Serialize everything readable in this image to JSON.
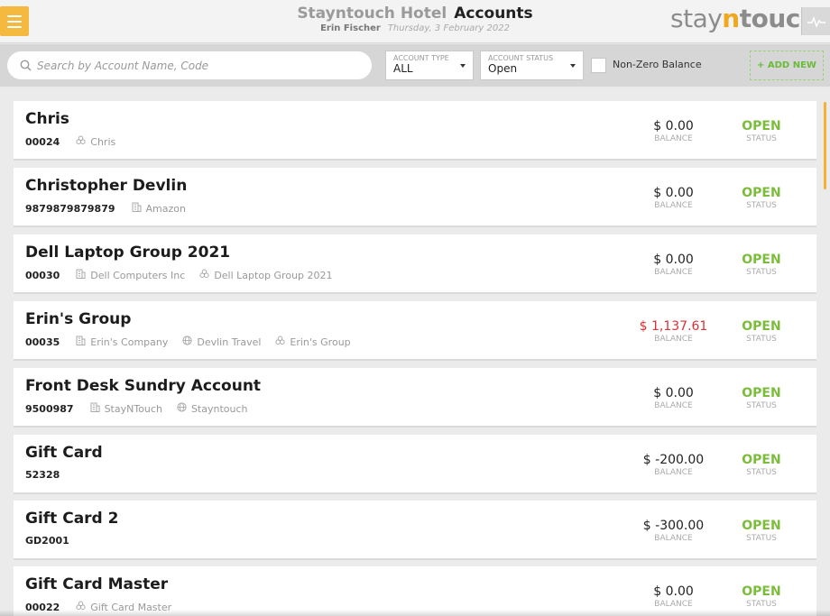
{
  "header": {
    "hotel_name": "Stayntouch Hotel",
    "page_title": "Accounts",
    "user_name": "Erin Fischer",
    "date": "Thursday, 3 February 2022",
    "logo": {
      "part1": "stay",
      "part2": "n",
      "part3": "touch"
    }
  },
  "filters": {
    "search_placeholder": "Search by Account Name, Code",
    "account_type": {
      "label": "ACCOUNT TYPE",
      "value": "ALL"
    },
    "account_status": {
      "label": "ACCOUNT STATUS",
      "value": "Open"
    },
    "non_zero_label": "Non-Zero Balance",
    "non_zero_checked": false,
    "add_new_label": "+ ADD NEW"
  },
  "labels": {
    "balance": "BALANCE",
    "status": "STATUS"
  },
  "colors": {
    "accent": "#f6b93f",
    "open_green": "#7bbd3a",
    "negative_red": "#d93333"
  },
  "accounts": [
    {
      "name": "Chris",
      "code": "00024",
      "tags": [
        {
          "icon": "group-icon",
          "text": "Chris"
        }
      ],
      "balance": "$ 0.00",
      "negative": false,
      "status": "OPEN"
    },
    {
      "name": "Christopher Devlin",
      "code": "9879879879879",
      "tags": [
        {
          "icon": "company-icon",
          "text": "Amazon"
        }
      ],
      "balance": "$ 0.00",
      "negative": false,
      "status": "OPEN"
    },
    {
      "name": "Dell Laptop Group 2021",
      "code": "00030",
      "tags": [
        {
          "icon": "company-icon",
          "text": "Dell Computers Inc"
        },
        {
          "icon": "group-icon",
          "text": "Dell Laptop Group 2021"
        }
      ],
      "balance": "$ 0.00",
      "negative": false,
      "status": "OPEN"
    },
    {
      "name": "Erin's Group",
      "code": "00035",
      "tags": [
        {
          "icon": "company-icon",
          "text": "Erin's Company"
        },
        {
          "icon": "globe-icon",
          "text": "Devlin Travel"
        },
        {
          "icon": "group-icon",
          "text": "Erin's Group"
        }
      ],
      "balance": "$ 1,137.61",
      "negative": true,
      "status": "OPEN"
    },
    {
      "name": "Front Desk Sundry Account",
      "code": "9500987",
      "tags": [
        {
          "icon": "company-icon",
          "text": "StayNTouch"
        },
        {
          "icon": "globe-icon",
          "text": "Stayntouch"
        }
      ],
      "balance": "$ 0.00",
      "negative": false,
      "status": "OPEN"
    },
    {
      "name": "Gift Card",
      "code": "52328",
      "tags": [],
      "balance": "$ -200.00",
      "negative": false,
      "status": "OPEN"
    },
    {
      "name": "Gift Card 2",
      "code": "GD2001",
      "tags": [],
      "balance": "$ -300.00",
      "negative": false,
      "status": "OPEN"
    },
    {
      "name": "Gift Card Master",
      "code": "00022",
      "tags": [
        {
          "icon": "group-icon",
          "text": "Gift Card Master"
        }
      ],
      "balance": "$ 0.00",
      "negative": false,
      "status": "OPEN"
    }
  ]
}
